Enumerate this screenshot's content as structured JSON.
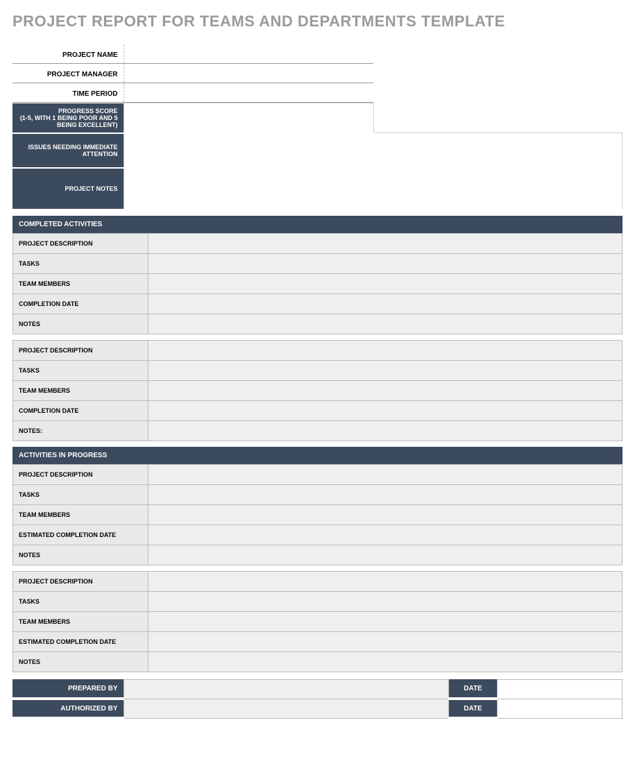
{
  "title": "PROJECT REPORT FOR TEAMS AND DEPARTMENTS TEMPLATE",
  "info": {
    "project_name_label": "PROJECT NAME",
    "project_name_value": "",
    "project_manager_label": "PROJECT MANAGER",
    "project_manager_value": "",
    "time_period_label": "TIME PERIOD",
    "time_period_value": ""
  },
  "summary": {
    "progress_score_label": "PROGRESS SCORE\n(1-5, WITH 1 BEING POOR AND 5 BEING EXCELLENT)",
    "progress_score_value": "",
    "issues_label": "ISSUES NEEDING IMMEDIATE ATTENTION",
    "issues_value": "",
    "project_notes_label": "PROJECT NOTES",
    "project_notes_value": ""
  },
  "completed": {
    "header": "COMPLETED ACTIVITIES",
    "groups": [
      {
        "project_description_label": "PROJECT DESCRIPTION",
        "project_description_value": "",
        "tasks_label": "TASKS",
        "tasks_value": "",
        "team_members_label": "TEAM MEMBERS",
        "team_members_value": "",
        "completion_date_label": "COMPLETION DATE",
        "completion_date_value": "",
        "notes_label": "NOTES",
        "notes_value": ""
      },
      {
        "project_description_label": "PROJECT DESCRIPTION",
        "project_description_value": "",
        "tasks_label": "TASKS",
        "tasks_value": "",
        "team_members_label": "TEAM MEMBERS",
        "team_members_value": "",
        "completion_date_label": "COMPLETION DATE",
        "completion_date_value": "",
        "notes_label": "NOTES:",
        "notes_value": ""
      }
    ]
  },
  "in_progress": {
    "header": "ACTIVITIES IN PROGRESS",
    "groups": [
      {
        "project_description_label": "PROJECT DESCRIPTION",
        "project_description_value": "",
        "tasks_label": "TASKS",
        "tasks_value": "",
        "team_members_label": "TEAM MEMBERS",
        "team_members_value": "",
        "est_completion_label": "ESTIMATED COMPLETION DATE",
        "est_completion_value": "",
        "notes_label": "NOTES",
        "notes_value": ""
      },
      {
        "project_description_label": "PROJECT DESCRIPTION",
        "project_description_value": "",
        "tasks_label": "TASKS",
        "tasks_value": "",
        "team_members_label": "TEAM MEMBERS",
        "team_members_value": "",
        "est_completion_label": "ESTIMATED COMPLETION DATE",
        "est_completion_value": "",
        "notes_label": "NOTES",
        "notes_value": ""
      }
    ]
  },
  "signoff": {
    "prepared_by_label": "PREPARED BY",
    "prepared_by_value": "",
    "prepared_date_label": "DATE",
    "prepared_date_value": "",
    "authorized_by_label": "AUTHORIZED BY",
    "authorized_by_value": "",
    "authorized_date_label": "DATE",
    "authorized_date_value": ""
  }
}
